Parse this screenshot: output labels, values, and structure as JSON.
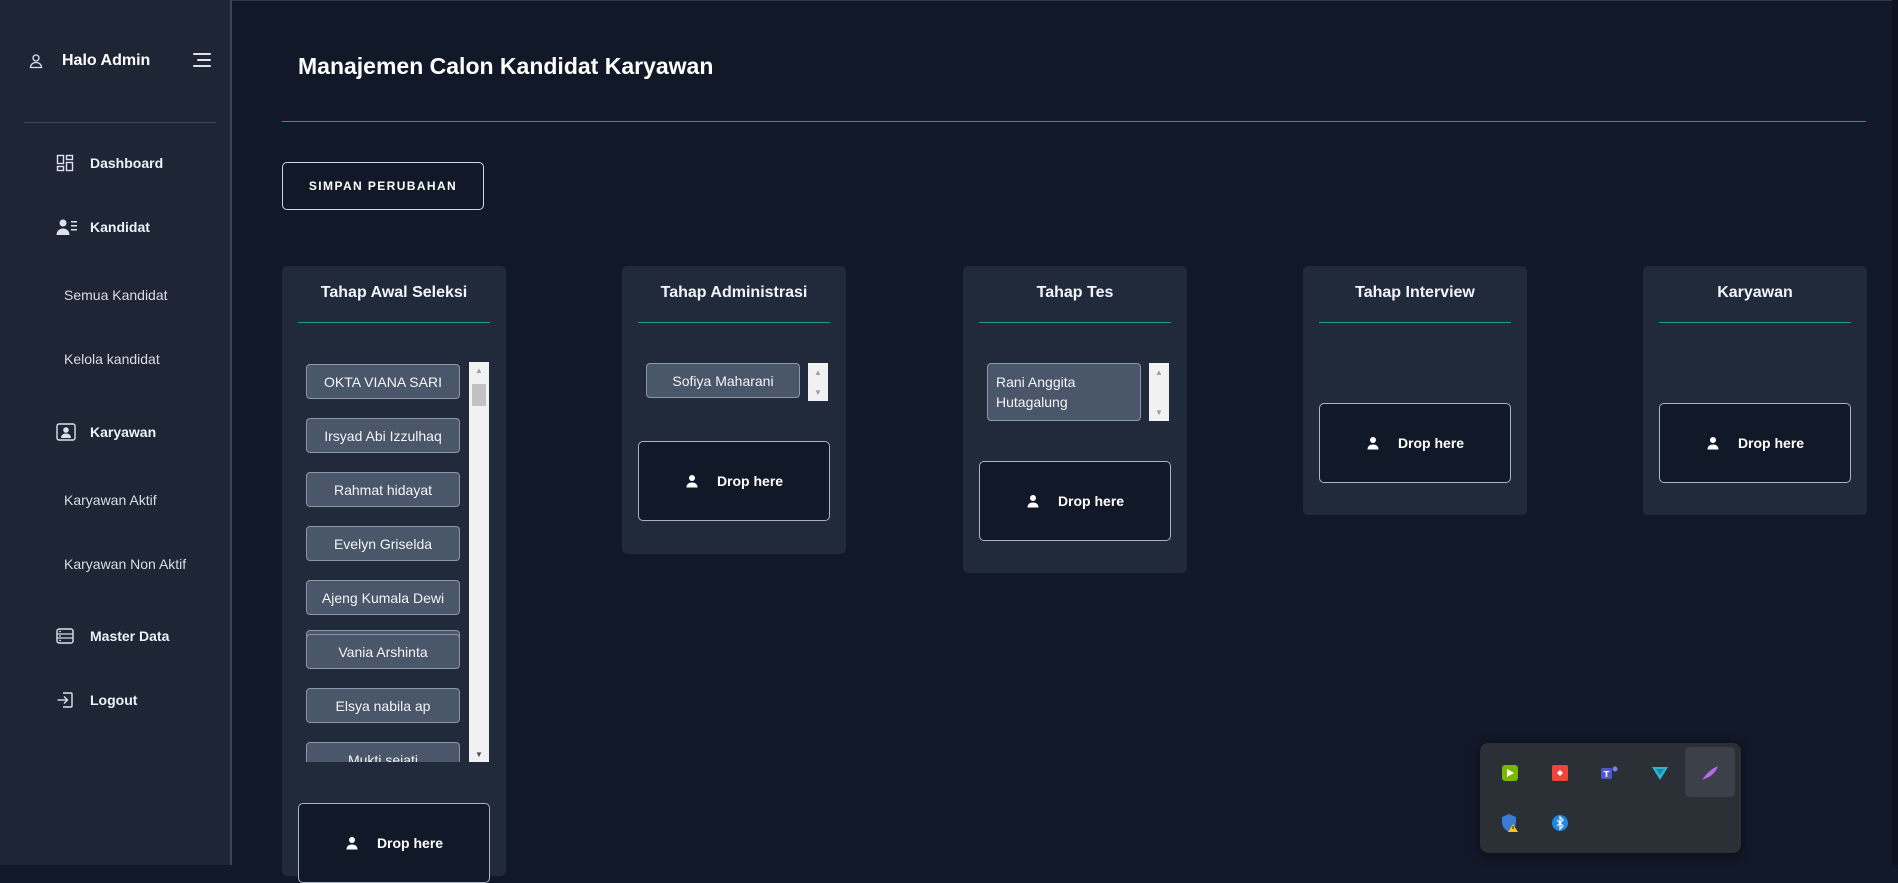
{
  "sidebar": {
    "title": "Halo Admin",
    "items": [
      {
        "label": "Dashboard",
        "icon": "dashboard-icon"
      },
      {
        "label": "Kandidat",
        "icon": "candidates-icon"
      },
      {
        "label": "Karyawan",
        "icon": "employee-icon"
      },
      {
        "label": "Master Data",
        "icon": "database-icon"
      },
      {
        "label": "Logout",
        "icon": "logout-icon"
      }
    ],
    "kandidat_sub": [
      "Semua Kandidat",
      "Kelola kandidat"
    ],
    "karyawan_sub": [
      "Karyawan Aktif",
      "Karyawan Non Aktif"
    ]
  },
  "main": {
    "title": "Manajemen Calon Kandidat Karyawan",
    "save_label": "SIMPAN PERUBAHAN",
    "drop_label": "Drop here",
    "columns": [
      {
        "title": "Tahap Awal Seleksi",
        "cards": [
          "OKTA VIANA SARI",
          "Irsyad Abi Izzulhaq",
          "Rahmat hidayat",
          "Evelyn Griselda",
          "Ajeng Kumala Dewi",
          "Vania Arshinta",
          "Elsya nabila ap",
          "Mukti sejati"
        ]
      },
      {
        "title": "Tahap Administrasi",
        "cards": [
          "Sofiya Maharani"
        ]
      },
      {
        "title": "Tahap Tes",
        "cards": [
          "Rani Anggita Hutagalung"
        ]
      },
      {
        "title": "Tahap Interview",
        "cards": []
      },
      {
        "title": "Karyawan",
        "cards": []
      }
    ]
  },
  "tray": {
    "icons": [
      "nvidia-icon",
      "anydesk-icon",
      "teams-icon",
      "vpn-shield-icon",
      "feather-app-icon",
      "security-warning-icon",
      "bluetooth-icon"
    ]
  },
  "colors": {
    "background": "#111827",
    "sidebar": "#1e2535",
    "column": "#212a3b",
    "accent": "#1f9e84",
    "card": "#4a5669"
  }
}
